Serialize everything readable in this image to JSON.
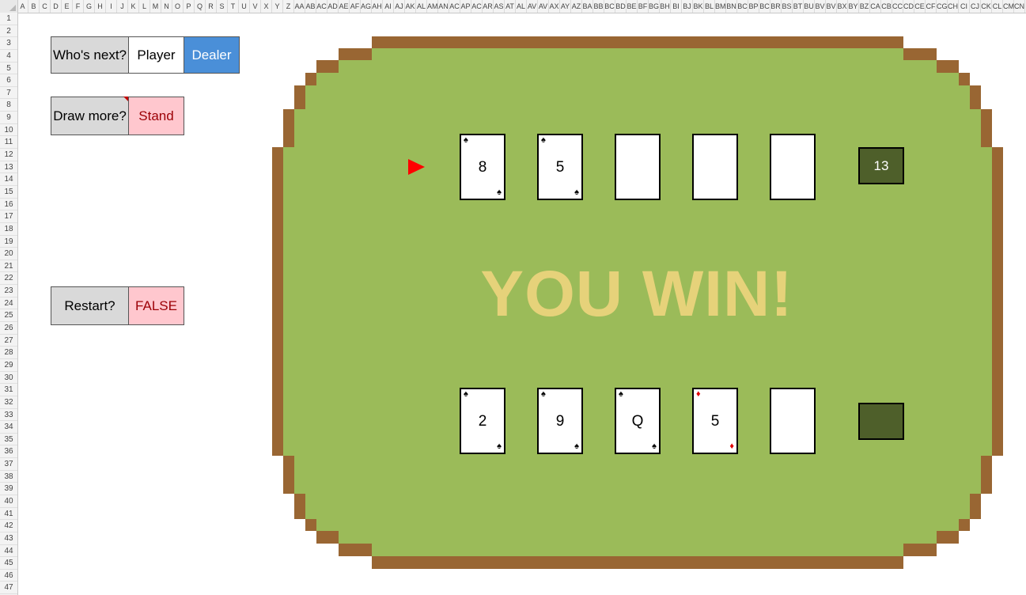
{
  "spreadsheet": {
    "columns": [
      "A",
      "B",
      "C",
      "D",
      "E",
      "F",
      "G",
      "H",
      "I",
      "J",
      "K",
      "L",
      "M",
      "N",
      "O",
      "P",
      "Q",
      "R",
      "S",
      "T",
      "U",
      "V",
      "X",
      "Y",
      "Z",
      "AA",
      "AB",
      "AC",
      "AD",
      "AE",
      "AF",
      "AG",
      "AH",
      "AI",
      "AJ",
      "AK",
      "AL",
      "AM",
      "AN",
      "AC",
      "AP",
      "AC",
      "AR",
      "AS",
      "AT",
      "AL",
      "AV",
      "AV",
      "AX",
      "AY",
      "AZ",
      "BA",
      "BB",
      "BC",
      "BD",
      "BE",
      "BF",
      "BG",
      "BH",
      "BI",
      "BJ",
      "BK",
      "BL",
      "BM",
      "BN",
      "BC",
      "BP",
      "BC",
      "BR",
      "BS",
      "BT",
      "BU",
      "BV",
      "BV",
      "BX",
      "BY",
      "BZ",
      "CA",
      "CB",
      "CC",
      "CD",
      "CE",
      "CF",
      "CG",
      "CH",
      "CI",
      "CJ",
      "CK",
      "CL",
      "CM",
      "CN"
    ],
    "rows": [
      "1",
      "2",
      "3",
      "4",
      "5",
      "6",
      "7",
      "8",
      "9",
      "10",
      "11",
      "12",
      "13",
      "14",
      "15",
      "16",
      "17",
      "18",
      "19",
      "20",
      "21",
      "22",
      "23",
      "24",
      "25",
      "26",
      "27",
      "28",
      "29",
      "30",
      "31",
      "32",
      "33",
      "34",
      "35",
      "36",
      "37",
      "38",
      "39",
      "40",
      "41",
      "42",
      "43",
      "44",
      "45",
      "46",
      "47"
    ]
  },
  "controls": {
    "whos_next": {
      "label": "Who's next?",
      "option_player": "Player",
      "option_dealer": "Dealer",
      "selected": "Dealer"
    },
    "draw_more": {
      "label": "Draw more?",
      "value": "Stand"
    },
    "restart": {
      "label": "Restart?",
      "value": "FALSE"
    }
  },
  "table": {
    "result_message": "YOU WIN!",
    "dealer": {
      "score": "13",
      "cards": [
        {
          "rank": "8",
          "suit": "♠",
          "color": "black"
        },
        {
          "rank": "5",
          "suit": "♠",
          "color": "black"
        },
        {
          "rank": "",
          "suit": "",
          "color": "black"
        },
        {
          "rank": "",
          "suit": "",
          "color": "black"
        },
        {
          "rank": "",
          "suit": "",
          "color": "black"
        }
      ]
    },
    "player": {
      "score": "",
      "cards": [
        {
          "rank": "2",
          "suit": "♠",
          "color": "black"
        },
        {
          "rank": "9",
          "suit": "♠",
          "color": "black"
        },
        {
          "rank": "Q",
          "suit": "♠",
          "color": "black"
        },
        {
          "rank": "5",
          "suit": "♦",
          "color": "red"
        },
        {
          "rank": "",
          "suit": "",
          "color": "black"
        }
      ]
    }
  },
  "colors": {
    "felt": "#9bbb59",
    "rail": "#996633",
    "score_box": "#4e5f2a",
    "result_text": "#e6d27a",
    "selected_option": "#4a8fd8",
    "pink_cell": "#ffc7ce"
  },
  "icons": {
    "turn_pointer": "red-triangle-pointer-icon"
  }
}
